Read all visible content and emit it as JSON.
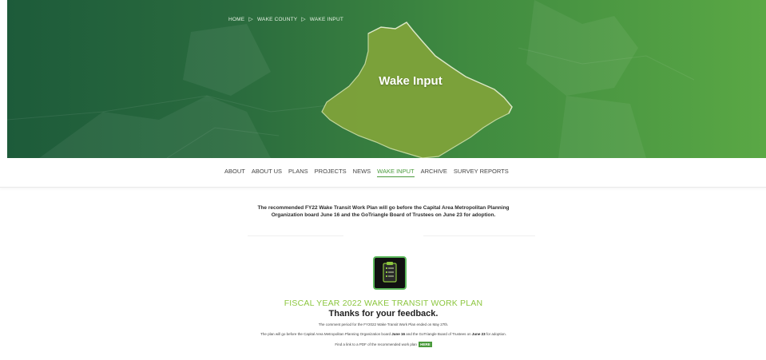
{
  "breadcrumb": {
    "home": "HOME",
    "county": "WAKE COUNTY",
    "current": "WAKE INPUT",
    "separator": "▷"
  },
  "hero": {
    "title": "Wake Input",
    "gradient_from": "#1d5b3a",
    "gradient_to": "#5aa845"
  },
  "nav": {
    "items": [
      "ABOUT",
      "ABOUT US",
      "PLANS",
      "PROJECTS",
      "NEWS",
      "WAKE INPUT",
      "ARCHIVE",
      "SURVEY REPORTS"
    ],
    "active": "WAKE INPUT",
    "active_color": "#4a9a3c"
  },
  "announcement": {
    "line1": "The recommended FY22 Wake Transit Work Plan will go before the Capital Area Metropolitan Planning",
    "line2": "Organization board June 16 and the GoTriangle Board of Trustees on June 23 for adoption."
  },
  "plan": {
    "icon": "clipboard-icon",
    "title": "FISCAL YEAR 2022 WAKE TRANSIT WORK PLAN",
    "title_color": "#8cc63f",
    "thanks": "Thanks for your feedback.",
    "period": "The comment period for the FY2022 Wake Transit Work Plan ended on May 27th.",
    "board_pre": "The plan will go before the Capital Area Metropolitan Planning Organization board ",
    "board_date1": "June 16",
    "board_mid": " and the GoTriangle Board of Trustees on ",
    "board_date2": "June 23",
    "board_post": " for adoption.",
    "link_text": "Find a link to a PDF of the recommended work plan",
    "here_label": "HERE"
  }
}
